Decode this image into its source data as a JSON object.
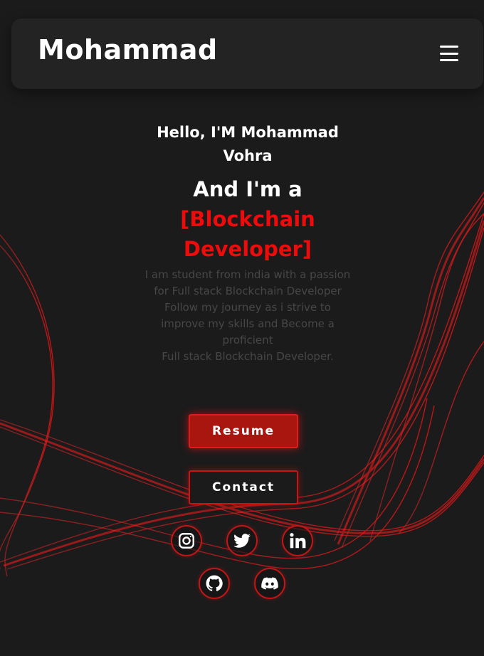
{
  "nav": {
    "logo": "Mohammad",
    "menu_icon": "hamburger-menu-icon"
  },
  "hero": {
    "greeting": "Hello, I'M Mohammad Vohra",
    "role_prefix": "And I'm a",
    "role_value": "[Blockchain Developer]",
    "description": "I am student from india with a passion for Full stack Blockchain Developer\nFollow my journey as i strive to improve my skills and Become a proficient\nFull stack Blockchain Developer."
  },
  "buttons": {
    "resume": "Resume",
    "contact": "Contact"
  },
  "social": [
    "instagram-icon",
    "twitter-icon",
    "linkedin-icon",
    "github-icon",
    "discord-icon"
  ],
  "colors": {
    "background": "#1b1b1c",
    "accent": "#ee0b0b",
    "navbar": "#232323"
  }
}
